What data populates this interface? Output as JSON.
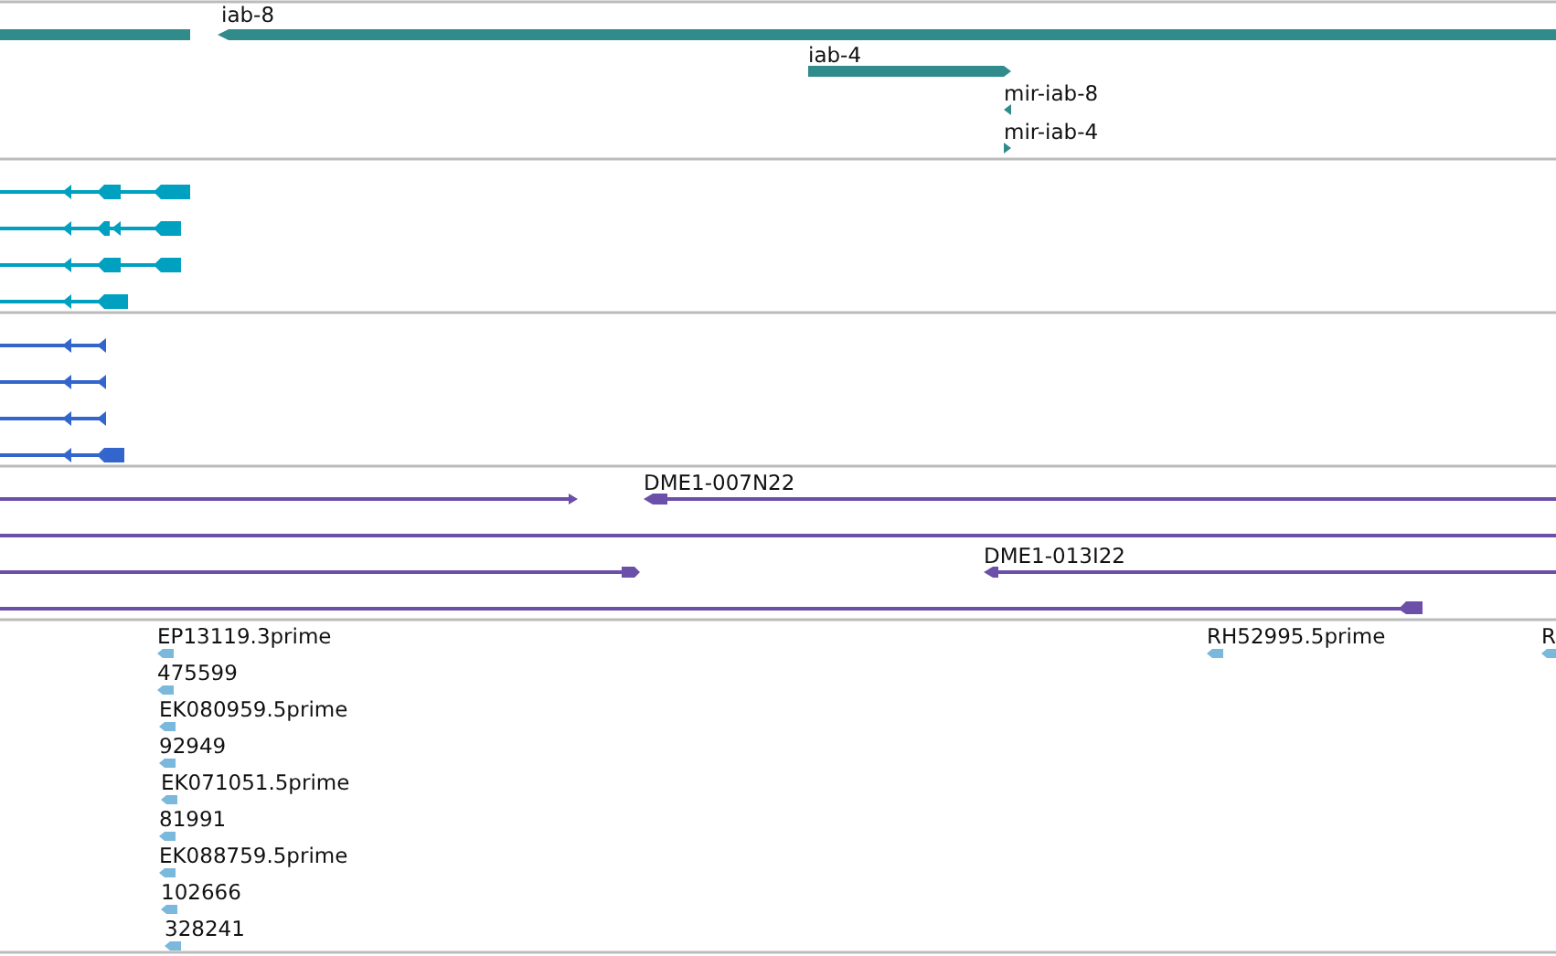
{
  "tracks": [
    {
      "color": "#318b8b",
      "features": [
        {
          "label": "iab-8"
        },
        {
          "label": "iab-4"
        },
        {
          "label": "mir-iab-8"
        },
        {
          "label": "mir-iab-4"
        }
      ]
    },
    {
      "color": "#00a0c0"
    },
    {
      "color": "#3366cc"
    },
    {
      "color": "#6b4fa8",
      "features": [
        {
          "label": "DME1-007N22"
        },
        {
          "label": "DME1-013I22"
        }
      ]
    },
    {
      "color": "#7ab8dc",
      "features": [
        {
          "label": "EP13119.3prime"
        },
        {
          "label": "475599"
        },
        {
          "label": "EK080959.5prime"
        },
        {
          "label": "92949"
        },
        {
          "label": "EK071051.5prime"
        },
        {
          "label": "81991"
        },
        {
          "label": "EK088759.5prime"
        },
        {
          "label": "102666"
        },
        {
          "label": "328241"
        },
        {
          "label": "RH52995.5prime"
        },
        {
          "label": "R"
        }
      ]
    }
  ]
}
